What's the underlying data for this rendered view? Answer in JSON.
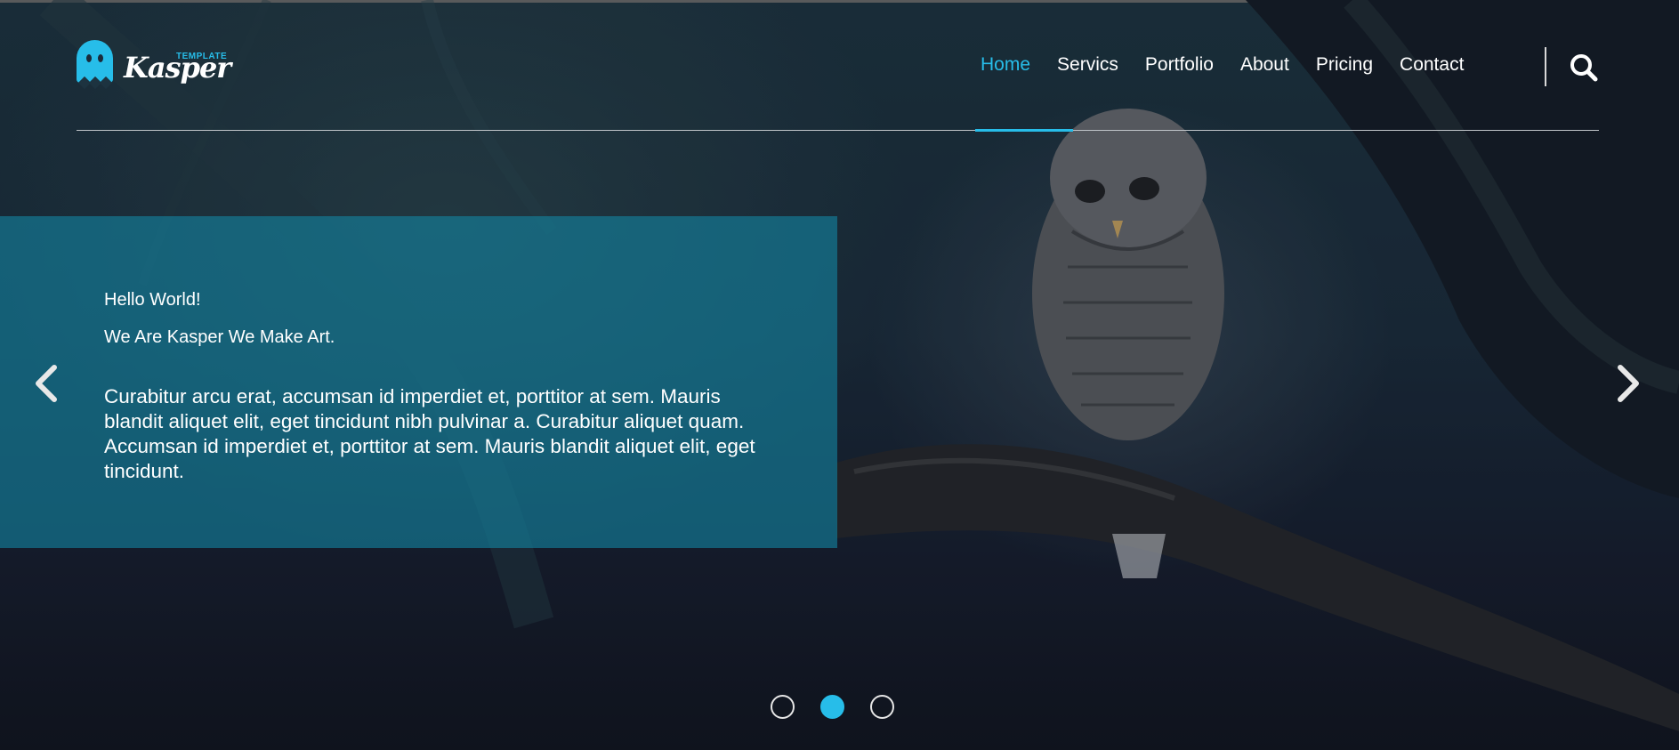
{
  "brand": {
    "name": "Kasper",
    "tagline": "TEMPLATE",
    "accent_color": "#27bde9",
    "logo_icon": "ghost-icon"
  },
  "nav": {
    "items": [
      {
        "label": "Home",
        "active": true
      },
      {
        "label": "Servics",
        "active": false
      },
      {
        "label": "Portfolio",
        "active": false
      },
      {
        "label": "About",
        "active": false
      },
      {
        "label": "Pricing",
        "active": false
      },
      {
        "label": "Contact",
        "active": false
      }
    ],
    "search_icon": "search-icon"
  },
  "slide": {
    "greeting": "Hello World!",
    "subtitle": "We Are Kasper We Make Art.",
    "body": "Curabitur arcu erat, accumsan id imperdiet et, porttitor at sem. Mauris blandit aliquet elit, eget tincidunt nibh pulvinar a. Curabitur aliquet quam. Accumsan id imperdiet et, porttitor at sem. Mauris blandit aliquet elit, eget tincidunt.",
    "background_image": "owl-on-branch-image"
  },
  "slider": {
    "prev_icon": "chevron-left-icon",
    "next_icon": "chevron-right-icon",
    "dot_count": 3,
    "active_dot": 2
  }
}
